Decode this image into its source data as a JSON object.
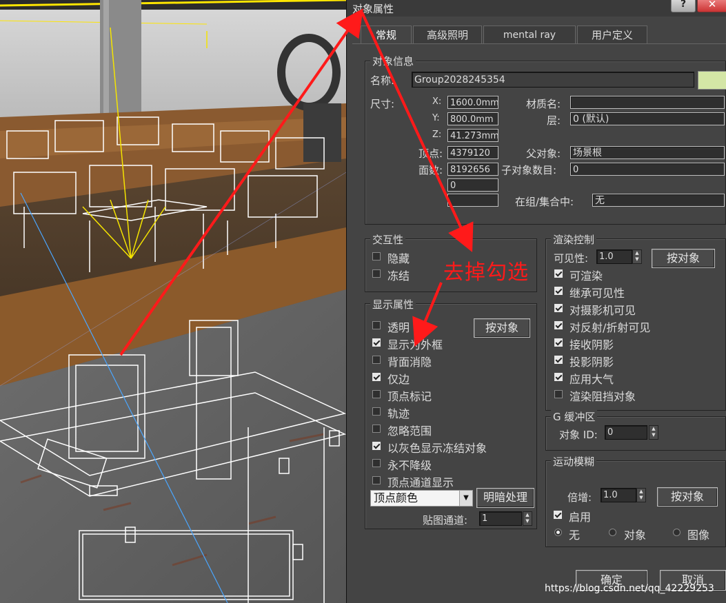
{
  "window": {
    "title": "对象属性",
    "help": "?",
    "close": "✕"
  },
  "tabs": [
    {
      "label": "常规"
    },
    {
      "label": "高级照明"
    },
    {
      "label": "mental ray"
    },
    {
      "label": "用户定义"
    }
  ],
  "object_info": {
    "group_title": "对象信息",
    "name_label": "名称:",
    "name_value": "Group2028245354",
    "color_swatch": "#d4e6a6",
    "dims_label": "尺寸:",
    "x_label": "X:",
    "x_value": "1600.0mm",
    "y_label": "Y:",
    "y_value": "800.0mm",
    "z_label": "Z:",
    "z_value": "41.273mm",
    "vertices_label": "顶点:",
    "vertices_value": "4379120",
    "faces_label": "面数:",
    "faces_value": "8192656",
    "extra_value": "0",
    "extra_value2": "",
    "material_label": "材质名:",
    "material_value": "",
    "layer_label": "层:",
    "layer_value": "0 (默认)",
    "parent_label": "父对象:",
    "parent_value": "场景根",
    "children_label": "子对象数目:",
    "children_value": "0",
    "group_label": "在组/集合中:",
    "group_value": "无"
  },
  "interactivity": {
    "title": "交互性",
    "items": [
      {
        "label": "隐藏",
        "checked": false
      },
      {
        "label": "冻结",
        "checked": false
      }
    ]
  },
  "display": {
    "title": "显示属性",
    "by_object": "按对象",
    "items": [
      {
        "label": "透明",
        "checked": false
      },
      {
        "label": "显示为外框",
        "checked": true
      },
      {
        "label": "背面消隐",
        "checked": false
      },
      {
        "label": "仅边",
        "checked": true
      },
      {
        "label": "顶点标记",
        "checked": false
      },
      {
        "label": "轨迹",
        "checked": false
      },
      {
        "label": "忽略范围",
        "checked": false
      },
      {
        "label": "以灰色显示冻结对象",
        "checked": true
      },
      {
        "label": "永不降级",
        "checked": false
      },
      {
        "label": "顶点通道显示",
        "checked": false
      }
    ],
    "vertex_color_option": "顶点颜色",
    "shading_button": "明暗处理",
    "map_channel_label": "贴图通道:",
    "map_channel_value": "1"
  },
  "render": {
    "title": "渲染控制",
    "visibility_label": "可见性:",
    "visibility_value": "1.0",
    "by_object": "按对象",
    "items": [
      {
        "label": "可渲染",
        "checked": true
      },
      {
        "label": "继承可见性",
        "checked": true
      },
      {
        "label": "对摄影机可见",
        "checked": true
      },
      {
        "label": "对反射/折射可见",
        "checked": true
      },
      {
        "label": "接收阴影",
        "checked": true
      },
      {
        "label": "投影阴影",
        "checked": true
      },
      {
        "label": "应用大气",
        "checked": true
      },
      {
        "label": "渲染阻挡对象",
        "checked": false
      }
    ]
  },
  "gbuffer": {
    "title": "G 缓冲区",
    "id_label": "对象 ID:",
    "id_value": "0"
  },
  "motion_blur": {
    "title": "运动模糊",
    "multiplier_label": "倍增:",
    "multiplier_value": "1.0",
    "by_object": "按对象",
    "enable_label": "启用",
    "enable_checked": true,
    "options": [
      {
        "label": "无",
        "selected": true
      },
      {
        "label": "对象",
        "selected": false
      },
      {
        "label": "图像",
        "selected": false
      }
    ]
  },
  "footer": {
    "ok": "确定",
    "cancel": "取消"
  },
  "annotation": {
    "text": "去掉勾选",
    "color": "#ff1a1a"
  },
  "watermark": "https://blog.csdn.net/qq_42229253"
}
